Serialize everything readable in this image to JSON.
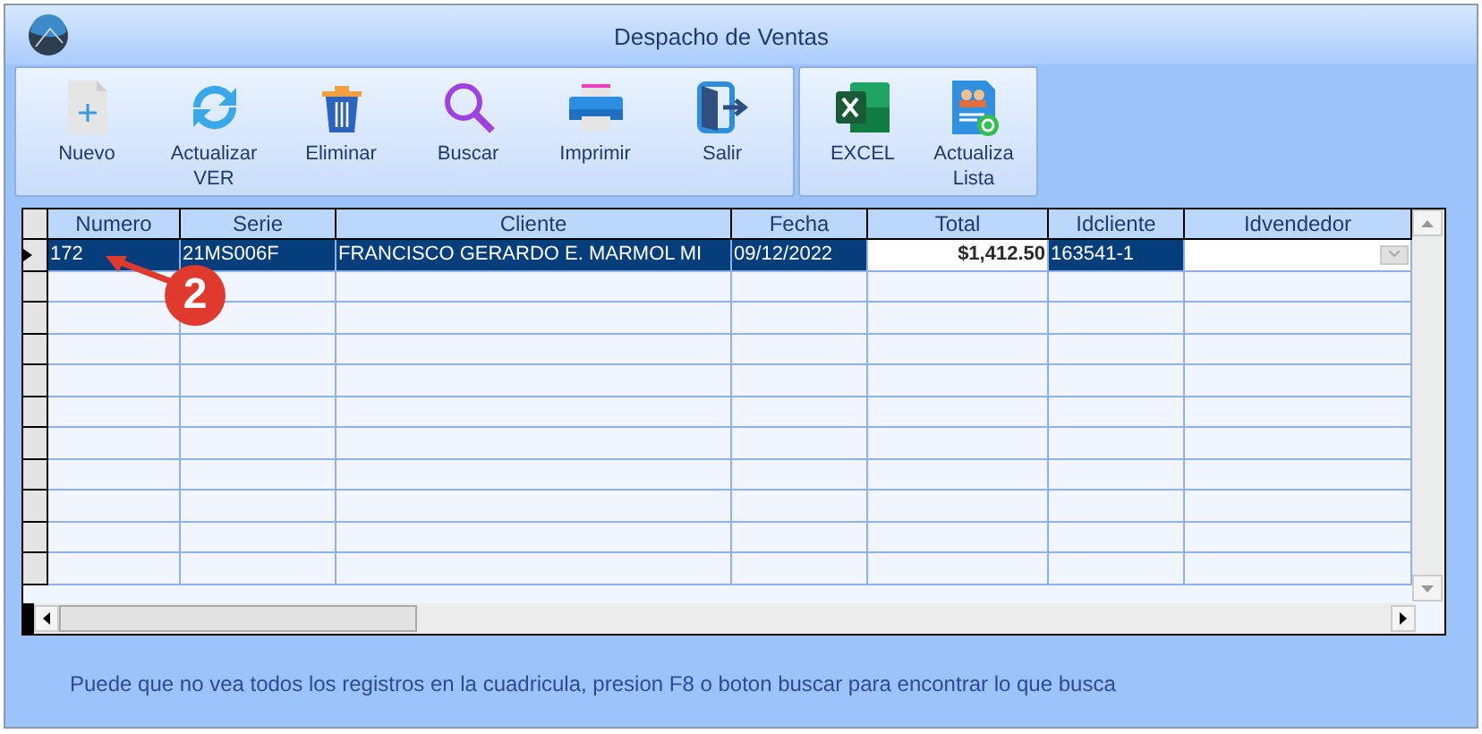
{
  "window": {
    "title": "Despacho de Ventas"
  },
  "toolbar": {
    "groups": [
      {
        "buttons": [
          {
            "label": "Nuevo"
          },
          {
            "label": "Actualizar\nVER"
          },
          {
            "label": "Eliminar"
          },
          {
            "label": "Buscar"
          },
          {
            "label": "Imprimir"
          },
          {
            "label": "Salir"
          }
        ]
      },
      {
        "buttons": [
          {
            "label": "EXCEL"
          },
          {
            "label": "Actualiza\nLista"
          }
        ]
      }
    ]
  },
  "table": {
    "columns": [
      "Numero",
      "Serie",
      "Cliente",
      "Fecha",
      "Total",
      "Idcliente",
      "Idvendedor"
    ],
    "rows": [
      {
        "selected": true,
        "cells": [
          {
            "text": "172",
            "focused": false
          },
          {
            "text": "21MS006F",
            "focused": false
          },
          {
            "text": "FRANCISCO GERARDO E. MARMOL MI",
            "focused": false
          },
          {
            "text": "09/12/2022",
            "focused": false
          },
          {
            "text": "$1,412.50",
            "focused": true
          },
          {
            "text": "163541-1",
            "focused": false
          },
          {
            "text": "",
            "focused": true,
            "kind": "combo"
          }
        ]
      }
    ]
  },
  "annotation": {
    "label": "2"
  },
  "footer": {
    "text": "Puede que no vea todos los registros en la cuadricula, presion F8 o boton buscar para encontrar lo que busca"
  }
}
